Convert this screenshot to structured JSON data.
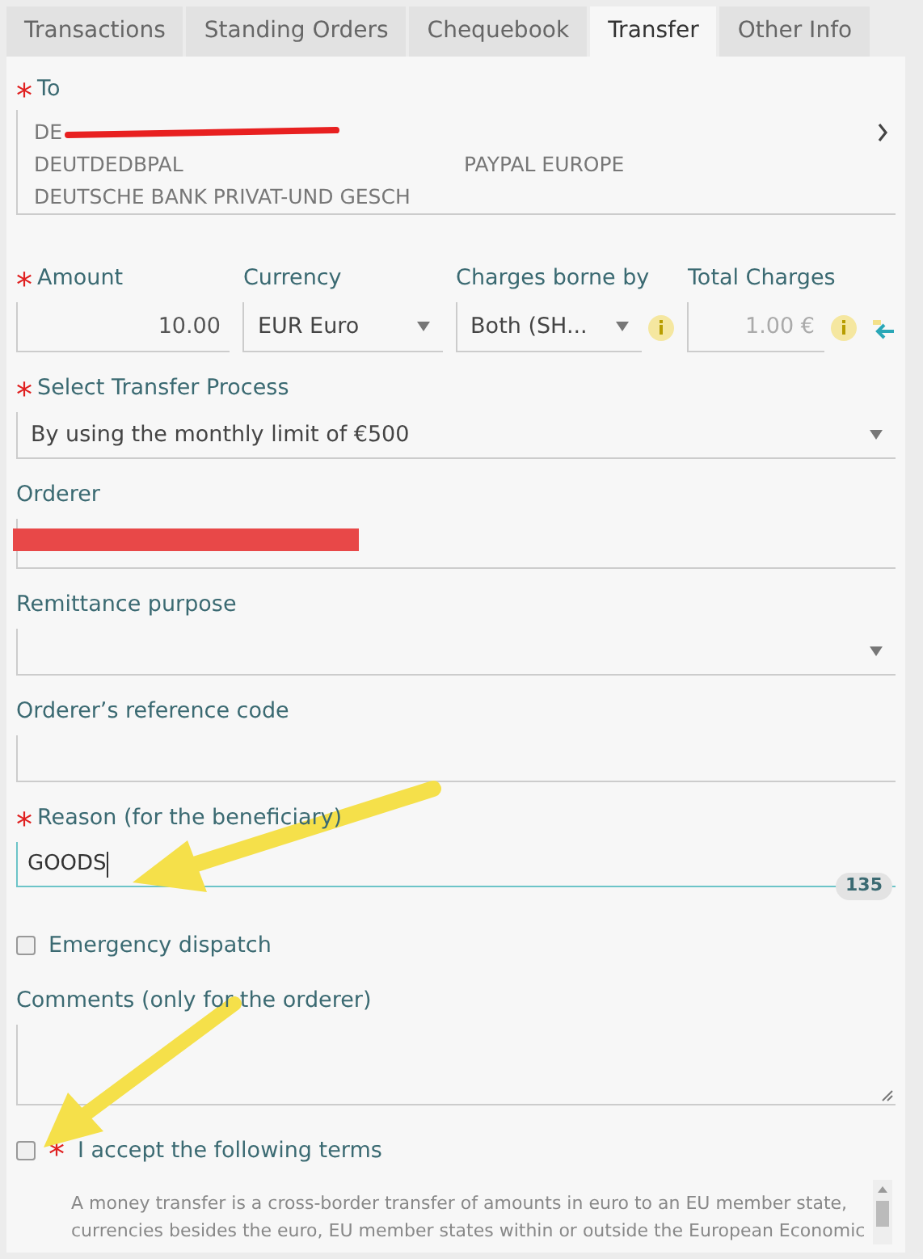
{
  "tabs": [
    {
      "label": "Transactions",
      "selected": false
    },
    {
      "label": "Standing Orders",
      "selected": false
    },
    {
      "label": "Chequebook",
      "selected": false
    },
    {
      "label": "Transfer",
      "selected": true
    },
    {
      "label": "Other Info",
      "selected": false
    }
  ],
  "recipient": {
    "label": "To",
    "marker": "*",
    "iban": "DE",
    "bic": "DEUTDEDBPAL",
    "name": "PAYPAL EUROPE",
    "bank": "DEUTSCHE BANK PRIVAT-UND GESCH"
  },
  "payment_row": [
    {
      "kind": "input",
      "label": "Amount",
      "marker": "*",
      "value": "10.00"
    },
    {
      "kind": "select",
      "label": "Currency",
      "value": "EUR Euro"
    },
    {
      "kind": "select",
      "label": "Charges borne by",
      "value": "Both (SH...",
      "info": true
    },
    {
      "kind": "readonly",
      "label": "Total Charges",
      "value": "1.00 €",
      "info": true
    }
  ],
  "fields": [
    {
      "kind": "select",
      "label": "Select Transfer Process",
      "marker": "*",
      "value": "By using the monthly limit of €500"
    },
    {
      "kind": "redacted",
      "label": "Orderer"
    },
    {
      "kind": "select",
      "label": "Remittance purpose"
    },
    {
      "kind": "input",
      "label": "Orderer’s reference code"
    },
    {
      "kind": "focused",
      "label": "Reason (for the beneficiary)",
      "marker": "*",
      "value": "GOODS",
      "counter": "135"
    },
    {
      "kind": "checkbox",
      "label": "Emergency dispatch",
      "checked": false
    },
    {
      "kind": "textarea",
      "label": "Comments (only for the orderer)"
    },
    {
      "kind": "checkbox",
      "label": "I accept the following terms",
      "marker": "*",
      "checked": false
    }
  ],
  "terms_text": [
    "A money transfer is a cross-border transfer of amounts in euro to an EU member state,",
    "currencies besides the euro, EU member states within or outside the European Economic"
  ]
}
